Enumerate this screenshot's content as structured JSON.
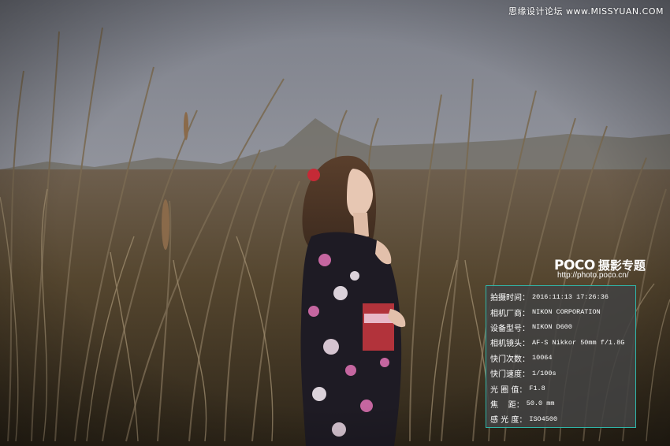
{
  "watermark_top": "思缘设计论坛 www.MISSYUAN.COM",
  "logo": {
    "brand": "POCO",
    "title": "摄影专题",
    "url": "http://photo.poco.cn/"
  },
  "exif": {
    "separator": "：",
    "rows": [
      {
        "key": "拍摄时间",
        "value": "2016:11:13 17:26:36"
      },
      {
        "key": "相机厂商",
        "value": "NIKON CORPORATION"
      },
      {
        "key": "设备型号",
        "value": "NIKON D600"
      },
      {
        "key": "相机镜头",
        "value": "AF-S Nikkor 50mm f/1.8G"
      },
      {
        "key": "快门次数",
        "value": "10064"
      },
      {
        "key": "快门速度",
        "value": "1/100s"
      },
      {
        "key": "光 圈 值",
        "value": "F1.8"
      },
      {
        "key": "焦    距",
        "value": "50.0 mm"
      },
      {
        "key": "感 光 度",
        "value": "ISO4500"
      }
    ]
  },
  "colors": {
    "sky": "#8c8f98",
    "grass": "#5a4a38",
    "panel_border": "#2fb5a8",
    "kimono": "#1e1b24",
    "flower_pink": "#d86fae"
  }
}
